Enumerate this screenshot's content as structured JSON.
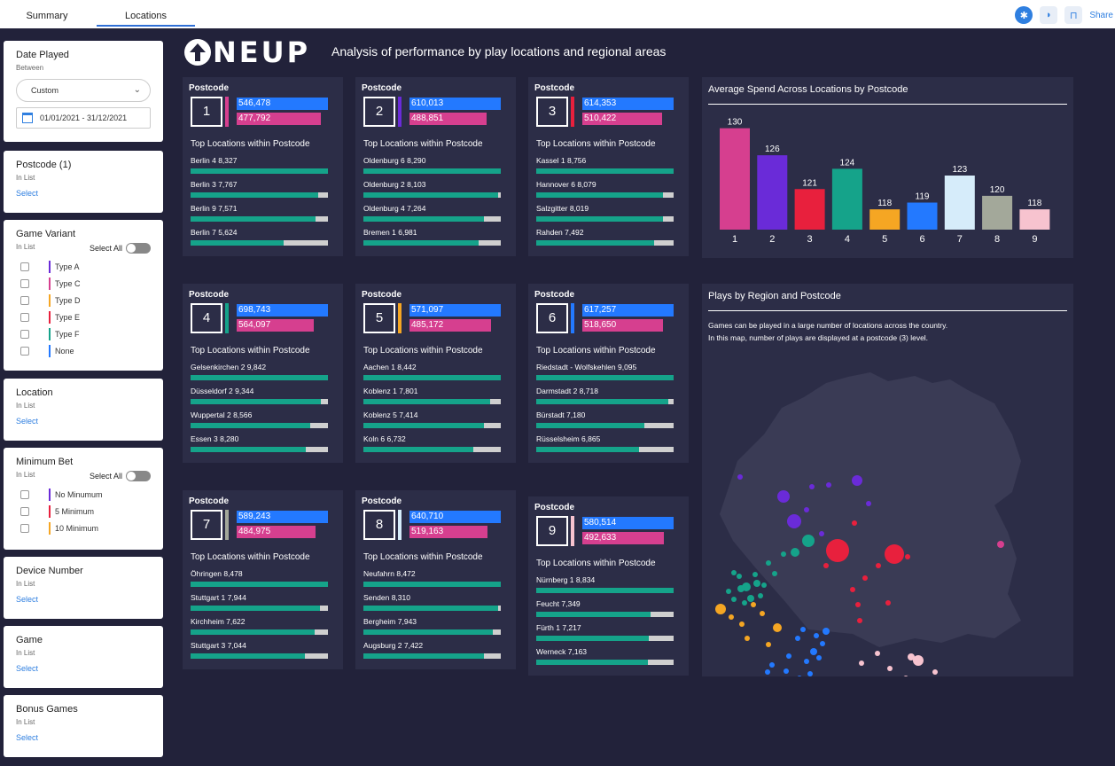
{
  "tabs": {
    "summary": "Summary",
    "locations": "Locations"
  },
  "toolbar": {
    "share_label": "Share"
  },
  "filters": {
    "date": {
      "title": "Date Played",
      "sub": "Between",
      "mode": "Custom",
      "range": "01/01/2021 - 31/12/2021"
    },
    "postcode": {
      "title": "Postcode (1)",
      "sub": "In List",
      "select": "Select"
    },
    "variant": {
      "title": "Game Variant",
      "sub": "In List",
      "select_all": "Select All",
      "options": [
        {
          "label": "Type A",
          "color": "#6a2bd8"
        },
        {
          "label": "Type C",
          "color": "#d63f8f"
        },
        {
          "label": "Type D",
          "color": "#f5a623"
        },
        {
          "label": "Type E",
          "color": "#e8203d"
        },
        {
          "label": "Type F",
          "color": "#15a38a"
        },
        {
          "label": "None",
          "color": "#2379ff"
        }
      ]
    },
    "location": {
      "title": "Location",
      "sub": "In List",
      "select": "Select"
    },
    "minbet": {
      "title": "Minimum Bet",
      "sub": "In List",
      "select_all": "Select All",
      "options": [
        {
          "label": "No Minumum",
          "color": "#6a2bd8"
        },
        {
          "label": "5 Minimum",
          "color": "#e8203d"
        },
        {
          "label": "10 Minimum",
          "color": "#f5a623"
        }
      ]
    },
    "device": {
      "title": "Device Number",
      "sub": "In List",
      "select": "Select"
    },
    "game": {
      "title": "Game",
      "sub": "In List",
      "select": "Select"
    },
    "bonus": {
      "title": "Bonus Games",
      "sub": "In List",
      "select": "Select"
    }
  },
  "header": {
    "logo": "NEUP",
    "subtitle": "Analysis of performance by play locations and regional areas"
  },
  "card_labels": {
    "title": "Postcode",
    "sub": "Top Locations within Postcode"
  },
  "cards": [
    {
      "num": "1",
      "color": "#d63f8f",
      "v1": "546,478",
      "v2": "477,792",
      "locs": [
        [
          "Berlin 4",
          "8,327",
          1.0
        ],
        [
          "Berlin 3",
          "7,767",
          0.93
        ],
        [
          "Berlin 9",
          "7,571",
          0.91
        ],
        [
          "Berlin 7",
          "5,624",
          0.68
        ]
      ]
    },
    {
      "num": "2",
      "color": "#6a2bd8",
      "v1": "610,013",
      "v2": "488,851",
      "locs": [
        [
          "Oldenburg 6",
          "8,290",
          1.0
        ],
        [
          "Oldenburg 2",
          "8,103",
          0.98
        ],
        [
          "Oldenburg 4",
          "7,264",
          0.88
        ],
        [
          "Bremen 1",
          "6,981",
          0.84
        ]
      ]
    },
    {
      "num": "3",
      "color": "#e8203d",
      "v1": "614,353",
      "v2": "510,422",
      "locs": [
        [
          "Kassel 1",
          "8,756",
          1.0
        ],
        [
          "Hannover 6",
          "8,079",
          0.92
        ],
        [
          "Salzgitter",
          "8,019",
          0.92
        ],
        [
          "Rahden",
          "7,492",
          0.86
        ]
      ]
    },
    {
      "num": "4",
      "color": "#15a38a",
      "v1": "698,743",
      "v2": "564,097",
      "locs": [
        [
          "Gelsenkirchen 2",
          "9,842",
          1.0
        ],
        [
          "Düsseldorf 2",
          "9,344",
          0.95
        ],
        [
          "Wuppertal 2",
          "8,566",
          0.87
        ],
        [
          "Essen 3",
          "8,280",
          0.84
        ]
      ]
    },
    {
      "num": "5",
      "color": "#f5a623",
      "v1": "571,097",
      "v2": "485,172",
      "locs": [
        [
          "Aachen 1",
          "8,442",
          1.0
        ],
        [
          "Koblenz 1",
          "7,801",
          0.92
        ],
        [
          "Koblenz 5",
          "7,414",
          0.88
        ],
        [
          "Koln 6",
          "6,732",
          0.8
        ]
      ]
    },
    {
      "num": "6",
      "color": "#2379ff",
      "v1": "617,257",
      "v2": "518,650",
      "locs": [
        [
          "Riedstadt - Wolfskehlen",
          "9,095",
          1.0
        ],
        [
          "Darmstadt 2",
          "8,718",
          0.96
        ],
        [
          "Bürstadt",
          "7,180",
          0.79
        ],
        [
          "Rüsselsheim",
          "6,865",
          0.75
        ]
      ]
    },
    {
      "num": "7",
      "color": "#a3a89a",
      "v1": "589,243",
      "v2": "484,975",
      "locs": [
        [
          "Öhringen",
          "8,478",
          1.0
        ],
        [
          "Stuttgart 1",
          "7,944",
          0.94
        ],
        [
          "Kirchheim",
          "7,622",
          0.9
        ],
        [
          "Stuttgart 3",
          "7,044",
          0.83
        ]
      ]
    },
    {
      "num": "8",
      "color": "#d6ecfa",
      "v1": "640,710",
      "v2": "519,163",
      "locs": [
        [
          "Neufahrn",
          "8,472",
          1.0
        ],
        [
          "Senden",
          "8,310",
          0.98
        ],
        [
          "Bergheim",
          "7,943",
          0.94
        ],
        [
          "Augsburg 2",
          "7,422",
          0.88
        ]
      ]
    },
    {
      "num": "9",
      "color": "#f7c3cf",
      "v1": "580,514",
      "v2": "492,633",
      "locs": [
        [
          "Nürnberg 1",
          "8,834",
          1.0
        ],
        [
          "Feucht",
          "7,349",
          0.83
        ],
        [
          "Fürth 1",
          "7,217",
          0.82
        ],
        [
          "Werneck",
          "7,163",
          0.81
        ]
      ]
    }
  ],
  "chart_data": {
    "type": "bar",
    "title": "Average Spend Across Locations by Postcode",
    "categories": [
      "1",
      "2",
      "3",
      "4",
      "5",
      "6",
      "7",
      "8",
      "9"
    ],
    "values": [
      130,
      126,
      121,
      124,
      118,
      119,
      123,
      120,
      118
    ],
    "colors": [
      "#d63f8f",
      "#6a2bd8",
      "#e8203d",
      "#15a38a",
      "#f5a623",
      "#2379ff",
      "#d6ecfa",
      "#a3a89a",
      "#f7c3cf"
    ],
    "ylim": [
      115,
      131
    ],
    "grid": false
  },
  "map": {
    "title": "Plays by Region and Postcode",
    "desc1": "Games can be played in a large number of locations across the country.",
    "desc2": "In this map, number of plays are displayed at a postcode (3) level."
  }
}
